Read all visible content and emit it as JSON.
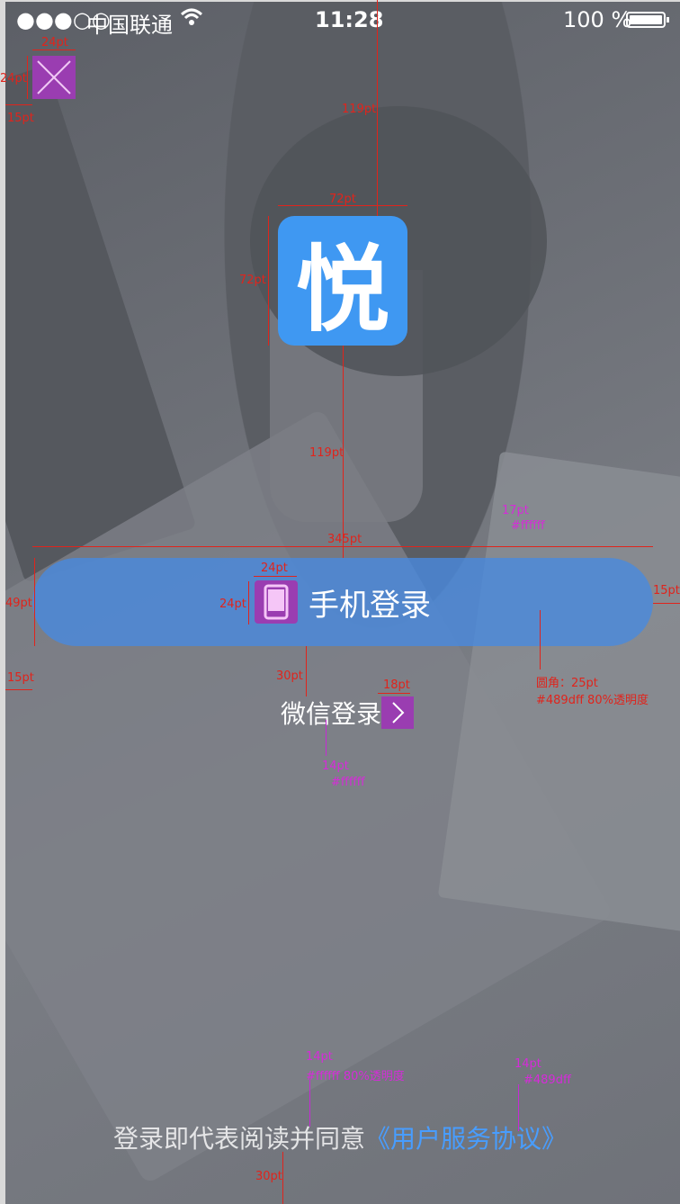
{
  "status_bar": {
    "signal": "●●●○○",
    "carrier": "中国联通",
    "time": "11:28",
    "battery_percent": "100 %"
  },
  "close_icon": "close-icon",
  "logo": {
    "glyph": "悦",
    "color": "#3f98f2"
  },
  "phone_login": {
    "label": "手机登录",
    "color": "#489dff",
    "opacity": 0.8
  },
  "wechat_login": {
    "label": "微信登录"
  },
  "agreement": {
    "text": "登录即代表阅读并同意",
    "link": "《用户服务协议》",
    "text_color": "#ffffff",
    "link_color": "#489dff"
  },
  "annotations": {
    "close_w": "24pt",
    "close_h": "24pt",
    "close_left": "15pt",
    "top_to_logo": "119pt",
    "logo_w": "72pt",
    "logo_h": "72pt",
    "logo_to_button": "119pt",
    "button_w": "345pt",
    "button_h": "49pt",
    "button_right": "15pt",
    "icon_w": "24pt",
    "icon_h": "24pt",
    "font_17": "17pt",
    "font_17_color": "#ffffff",
    "radius": "圆角：25pt",
    "button_color": "#489dff 80%透明度",
    "gap_30": "30pt",
    "button_left": "15pt",
    "arrow_w": "18pt",
    "font_14": "14pt",
    "font_14_color": "#ffffff",
    "agree_size": "14pt",
    "agree_color": "#ffffff 80%透明度",
    "link_size": "14pt",
    "link_color": "#489dff",
    "bottom_gap": "30pt"
  }
}
